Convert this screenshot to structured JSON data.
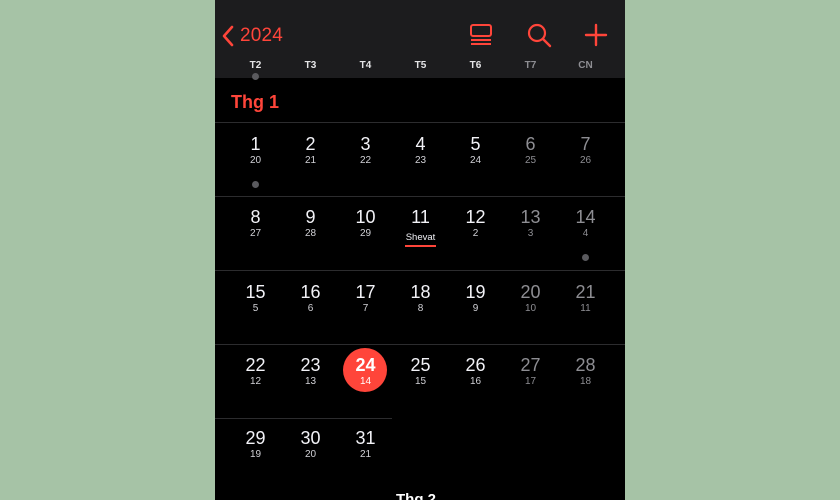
{
  "header": {
    "back_label": "2024",
    "icons": [
      "list-view-icon",
      "search-icon",
      "add-icon"
    ]
  },
  "weekdays": [
    "T2",
    "T3",
    "T4",
    "T5",
    "T6",
    "T7",
    "CN"
  ],
  "month": {
    "label": "Thg 1"
  },
  "days": [
    {
      "day": "1",
      "lunar": "20"
    },
    {
      "day": "2",
      "lunar": "21"
    },
    {
      "day": "3",
      "lunar": "22"
    },
    {
      "day": "4",
      "lunar": "23"
    },
    {
      "day": "5",
      "lunar": "24"
    },
    {
      "day": "6",
      "lunar": "25"
    },
    {
      "day": "7",
      "lunar": "26"
    },
    {
      "day": "8",
      "lunar": "27"
    },
    {
      "day": "9",
      "lunar": "28"
    },
    {
      "day": "10",
      "lunar": "29"
    },
    {
      "day": "11",
      "lunar": "Shevat"
    },
    {
      "day": "12",
      "lunar": "2"
    },
    {
      "day": "13",
      "lunar": "3"
    },
    {
      "day": "14",
      "lunar": "4"
    },
    {
      "day": "15",
      "lunar": "5"
    },
    {
      "day": "16",
      "lunar": "6"
    },
    {
      "day": "17",
      "lunar": "7"
    },
    {
      "day": "18",
      "lunar": "8"
    },
    {
      "day": "19",
      "lunar": "9"
    },
    {
      "day": "20",
      "lunar": "10"
    },
    {
      "day": "21",
      "lunar": "11"
    },
    {
      "day": "22",
      "lunar": "12"
    },
    {
      "day": "23",
      "lunar": "13"
    },
    {
      "day": "24",
      "lunar": "14"
    },
    {
      "day": "25",
      "lunar": "15"
    },
    {
      "day": "26",
      "lunar": "16"
    },
    {
      "day": "27",
      "lunar": "17"
    },
    {
      "day": "28",
      "lunar": "18"
    },
    {
      "day": "29",
      "lunar": "19"
    },
    {
      "day": "30",
      "lunar": "20"
    },
    {
      "day": "31",
      "lunar": "21"
    }
  ],
  "today": "24",
  "next_month_partial": "Thg 2",
  "colors": {
    "accent": "#ff453a",
    "background": "#000000",
    "header_bg": "#1c1c1e",
    "page_bg": "#a6c3a6"
  }
}
